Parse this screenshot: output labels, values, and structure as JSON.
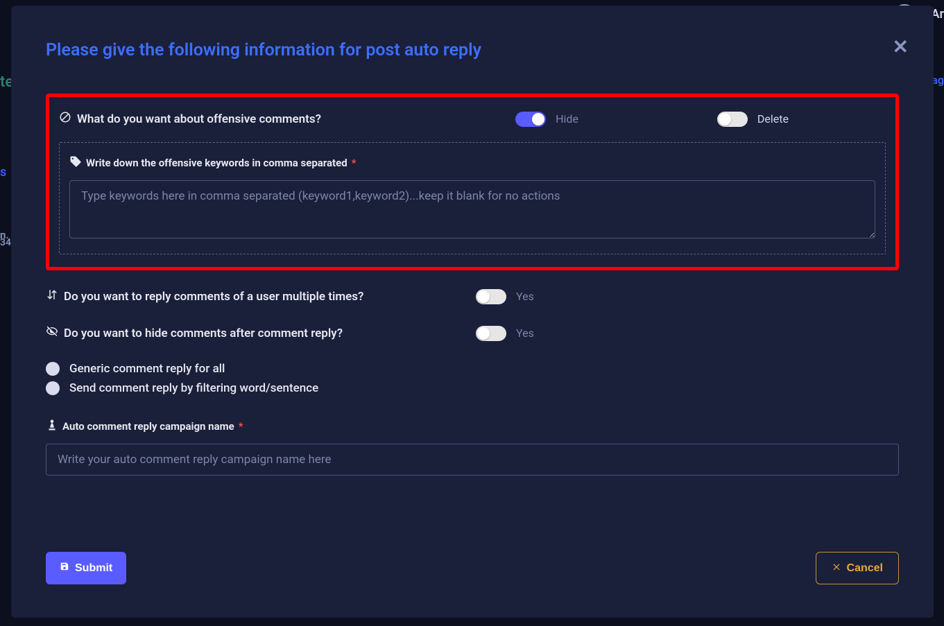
{
  "background": {
    "left_text1": "te",
    "left_text2": "s",
    "left_text3": "n.",
    "left_text4": "34",
    "right_user": "Ar",
    "right_link": "ag"
  },
  "modal": {
    "title": "Please give the following information for post auto reply",
    "offensive": {
      "question": "What do you want about offensive comments?",
      "hide_label": "Hide",
      "hide_on": true,
      "delete_label": "Delete",
      "delete_on": false,
      "keywords_label": "Write down the offensive keywords in comma separated",
      "keywords_placeholder": "Type keywords here in comma separated (keyword1,keyword2)...keep it blank for no actions",
      "keywords_value": ""
    },
    "reply_multiple": {
      "question": "Do you want to reply comments of a user multiple times?",
      "option_label": "Yes",
      "on": false
    },
    "hide_after_reply": {
      "question": "Do you want to hide comments after comment reply?",
      "option_label": "Yes",
      "on": false
    },
    "reply_mode": {
      "option_generic": "Generic comment reply for all",
      "option_filter": "Send comment reply by filtering word/sentence"
    },
    "campaign": {
      "label": "Auto comment reply campaign name",
      "placeholder": "Write your auto comment reply campaign name here",
      "value": ""
    },
    "buttons": {
      "submit": "Submit",
      "cancel": "Cancel"
    }
  }
}
